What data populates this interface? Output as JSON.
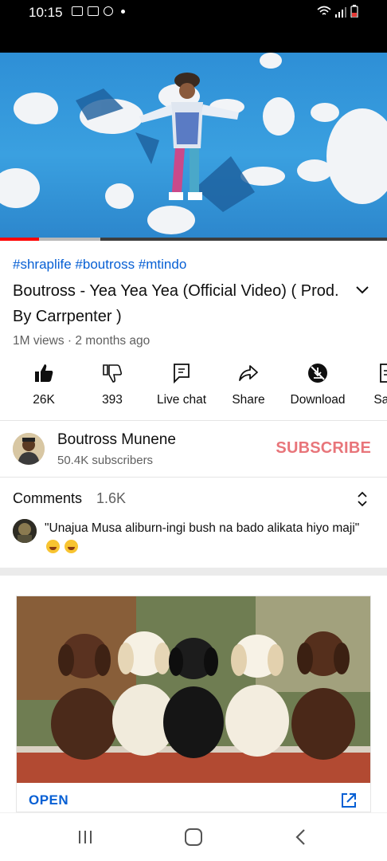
{
  "status_bar": {
    "time": "10:15"
  },
  "video": {
    "progress_played": 0.1,
    "progress_buffered": 0.26
  },
  "meta": {
    "hashtags": "#shraplife #boutross #mtindo",
    "title": "Boutross - Yea Yea Yea (Official Video) ( Prod. By Carrpenter )",
    "views": "1M views · 2 months ago"
  },
  "actions": {
    "like": "26K",
    "dislike": "393",
    "live_chat": "Live chat",
    "share": "Share",
    "download": "Download",
    "save": "Save"
  },
  "channel": {
    "name": "Boutross Munene",
    "subscribers": "50.4K subscribers",
    "subscribe_label": "SUBSCRIBE"
  },
  "comments": {
    "label": "Comments",
    "count": "1.6K",
    "top_comment": "\"Unajua Musa aliburn-ingi bush na bado alikata hiyo maji\""
  },
  "ad": {
    "open_label": "OPEN"
  },
  "colors": {
    "link_blue": "#065fd4",
    "subscribe_red": "#e8757a",
    "progress_red": "#ff0000"
  }
}
